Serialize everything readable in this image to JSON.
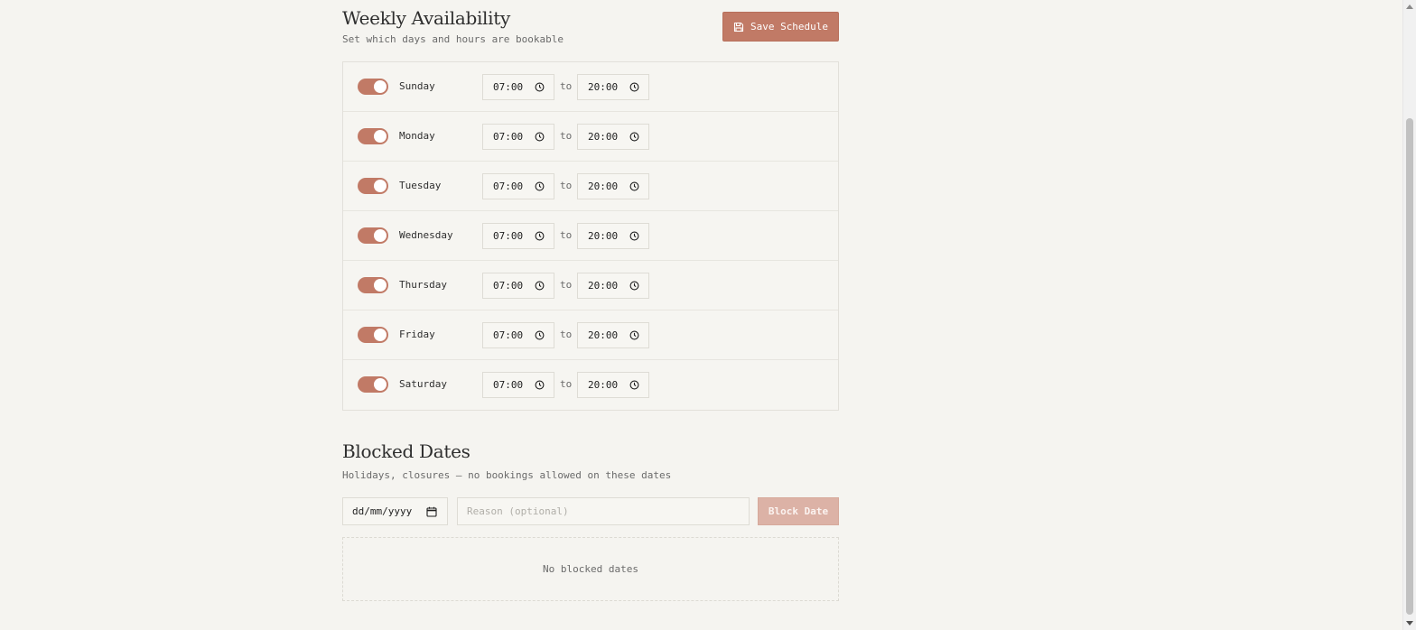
{
  "weekly": {
    "title": "Weekly Availability",
    "subtitle": "Set which days and hours are bookable",
    "save_label": "Save Schedule",
    "to_label": "to",
    "days": [
      {
        "name": "Sunday",
        "enabled": true,
        "start": "07:00",
        "end": "20:00"
      },
      {
        "name": "Monday",
        "enabled": true,
        "start": "07:00",
        "end": "20:00"
      },
      {
        "name": "Tuesday",
        "enabled": true,
        "start": "07:00",
        "end": "20:00"
      },
      {
        "name": "Wednesday",
        "enabled": true,
        "start": "07:00",
        "end": "20:00"
      },
      {
        "name": "Thursday",
        "enabled": true,
        "start": "07:00",
        "end": "20:00"
      },
      {
        "name": "Friday",
        "enabled": true,
        "start": "07:00",
        "end": "20:00"
      },
      {
        "name": "Saturday",
        "enabled": true,
        "start": "07:00",
        "end": "20:00"
      }
    ]
  },
  "blocked": {
    "title": "Blocked Dates",
    "subtitle": "Holidays, closures — no bookings allowed on these dates",
    "date_placeholder": "dd/mm/yyyy",
    "reason_placeholder": "Reason (optional)",
    "block_label": "Block Date",
    "empty_text": "No blocked dates"
  },
  "colors": {
    "accent": "#c17a66",
    "accent_disabled": "#dcb2a6",
    "background": "#f5f4f0"
  }
}
